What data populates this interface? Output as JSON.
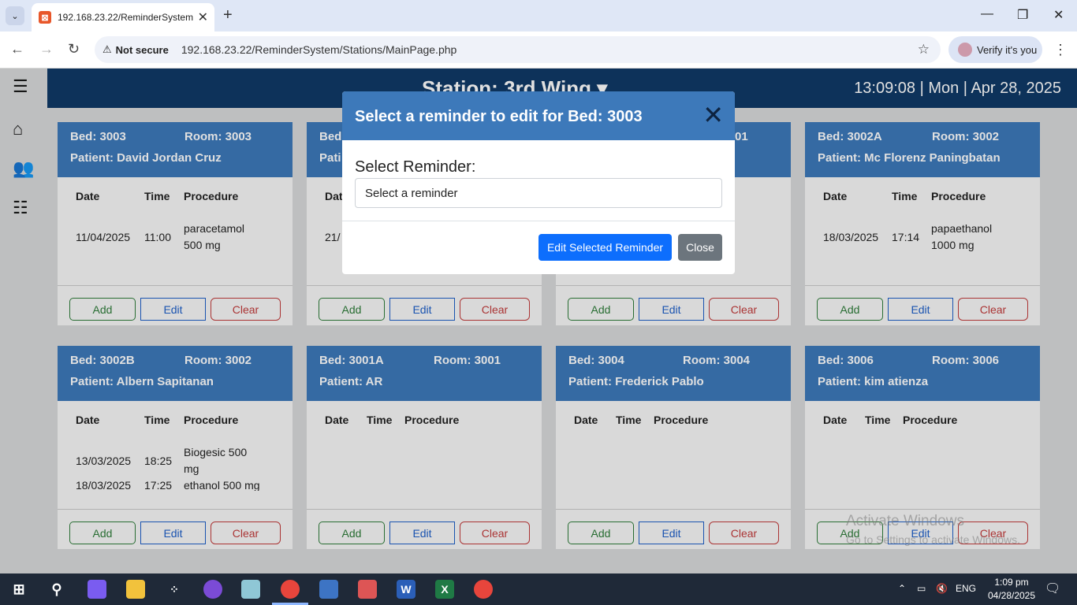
{
  "browser": {
    "tab_title": "192.168.23.22/ReminderSystem",
    "not_secure_label": "Not secure",
    "url": "192.168.23.22/ReminderSystem/Stations/MainPage.php",
    "verify_label": "Verify it's you"
  },
  "header": {
    "station": "Station: 3rd Wing ▾",
    "clock": "13:09:08 | Mon | Apr 28, 2025"
  },
  "table_headers": {
    "date": "Date",
    "time": "Time",
    "procedure": "Procedure"
  },
  "buttons": {
    "add": "Add",
    "edit": "Edit",
    "clear": "Clear"
  },
  "cards": [
    {
      "bed": "Bed: 3003",
      "room": "Room: 3003",
      "patient": "Patient: David Jordan Cruz",
      "rows": [
        {
          "date": "11/04/2025",
          "time": "11:00",
          "procedure": "paracetamol 500 mg"
        }
      ]
    },
    {
      "bed": "Bed",
      "room": "",
      "patient": "Pati",
      "rows": [
        {
          "date": "21/",
          "time": "",
          "procedure": ""
        }
      ]
    },
    {
      "bed": "",
      "room": "01",
      "patient": "",
      "rows": []
    },
    {
      "bed": "Bed: 3002A",
      "room": "Room: 3002",
      "patient": "Patient: Mc Florenz Paningbatan",
      "rows": [
        {
          "date": "18/03/2025",
          "time": "17:14",
          "procedure": "papaethanol 1000 mg"
        }
      ]
    },
    {
      "bed": "Bed: 3002B",
      "room": "Room: 3002",
      "patient": "Patient: Albern Sapitanan",
      "rows": [
        {
          "date": "13/03/2025",
          "time": "18:25",
          "procedure": "Biogesic 500 mg"
        },
        {
          "date": "18/03/2025",
          "time": "17:25",
          "procedure": "ethanol 500 mg"
        }
      ]
    },
    {
      "bed": "Bed: 3001A",
      "room": "Room: 3001",
      "patient": "Patient: AR",
      "rows": []
    },
    {
      "bed": "Bed: 3004",
      "room": "Room: 3004",
      "patient": "Patient: Frederick Pablo",
      "rows": []
    },
    {
      "bed": "Bed: 3006",
      "room": "Room: 3006",
      "patient": "Patient: kim atienza",
      "rows": []
    }
  ],
  "modal": {
    "title": "Select a reminder to edit for Bed: 3003",
    "label": "Select Reminder:",
    "select_value": "Select a reminder",
    "edit_button": "Edit Selected Reminder",
    "close_button": "Close"
  },
  "watermark": {
    "line1": "Activate Windows",
    "line2": "Go to Settings to activate Windows."
  },
  "taskbar": {
    "lang": "ENG",
    "time": "1:09 pm",
    "date": "04/28/2025"
  }
}
